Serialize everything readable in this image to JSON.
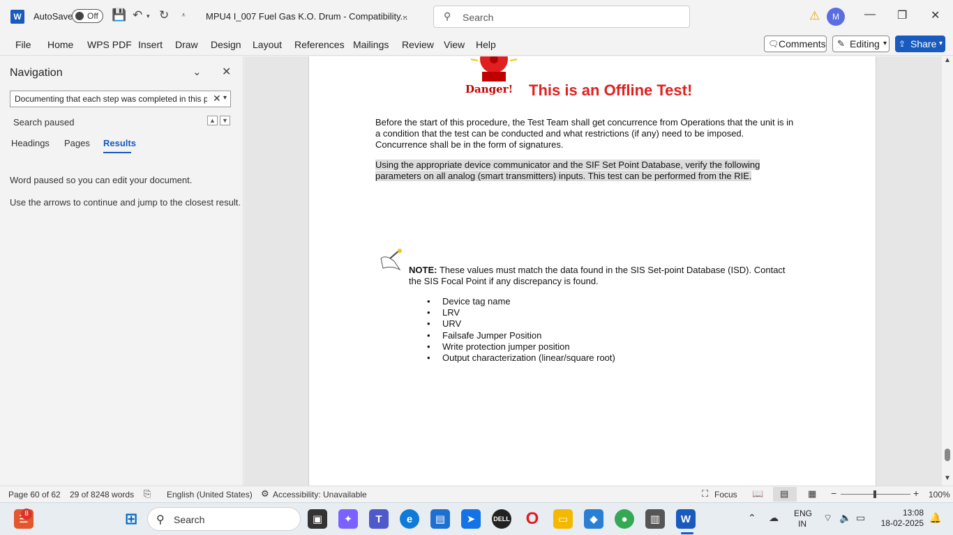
{
  "titlebar": {
    "autosave_label": "AutoSave",
    "autosave_state": "Off",
    "doc_title": "MPU4 I_007 Fuel Gas K.O. Drum  -  Compatibility...",
    "search_placeholder": "Search",
    "avatar_initial": "M"
  },
  "ribbon": {
    "tabs": [
      "File",
      "Home",
      "WPS PDF",
      "Insert",
      "Draw",
      "Design",
      "Layout",
      "References",
      "Mailings",
      "Review",
      "View",
      "Help"
    ],
    "comments_label": "Comments",
    "editing_label": "Editing",
    "share_label": "Share"
  },
  "navigation": {
    "title": "Navigation",
    "search_value": "Documenting that each step was completed in this p",
    "status": "Search paused",
    "tabs": [
      "Headings",
      "Pages",
      "Results"
    ],
    "active_tab": "Results",
    "messages": [
      "Word paused so you can edit your document.",
      "Use the arrows to continue and jump to the closest result."
    ]
  },
  "document": {
    "danger_label": "Danger!",
    "danger_title": "This is an Offline Test!",
    "para1": "Before the start of this procedure, the Test Team shall get concurrence from Operations that the unit is in a condition that the test can be conducted and what restrictions (if any) need to be imposed. Concurrence shall be in the form of signatures.",
    "para2": "Using the appropriate device communicator and the SIF Set Point Database, verify the following parameters on all analog (smart transmitters) inputs. This test can be performed from the RIE.",
    "note_label": "NOTE:",
    "note_text": " These values must match the data found in the SIS Set-point Database (ISD). Contact the SIS Focal Point if any discrepancy is found.",
    "bullets": [
      "Device tag name",
      "LRV",
      "URV",
      "Failsafe Jumper Position",
      "Write protection jumper position",
      "Output characterization (linear/square root)"
    ]
  },
  "statusbar": {
    "page": "Page 60 of 62",
    "words": "29 of 8248 words",
    "language": "English (United States)",
    "accessibility": "Accessibility: Unavailable",
    "focus": "Focus",
    "zoom": "100%"
  },
  "taskbar": {
    "search_placeholder": "Search",
    "notification_count": "8",
    "lang_line1": "ENG",
    "lang_line2": "IN",
    "time": "13:08",
    "date": "18-02-2025"
  },
  "colors": {
    "accent": "#185abd",
    "danger": "#e02020"
  }
}
